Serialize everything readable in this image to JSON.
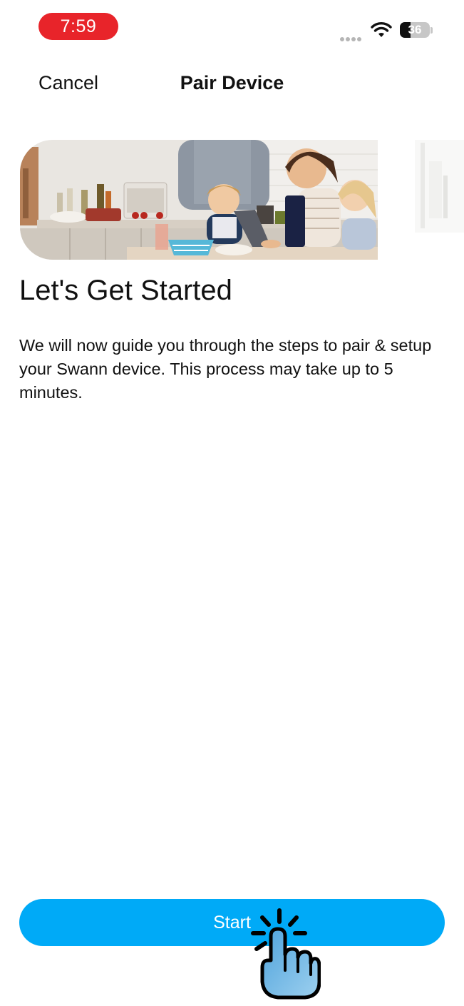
{
  "status_bar": {
    "time": "7:59",
    "time_pill_color": "#e8242a",
    "battery_level": "36",
    "battery_fraction": 0.36,
    "icons": [
      "signal-dots-icon",
      "wifi-icon",
      "battery-icon"
    ]
  },
  "nav": {
    "cancel_label": "Cancel",
    "title": "Pair Device"
  },
  "hero": {
    "image_alt": "Family in kitchen using tablet",
    "carousel_next_peek": true
  },
  "content": {
    "headline": "Let's Get Started",
    "description": "We will now guide you through the steps to pair & setup your Swann device. This process may take up to 5 minutes."
  },
  "footer": {
    "start_label": "Start",
    "button_color": "#00aaf7"
  },
  "overlay": {
    "icon": "tap-hand-icon"
  }
}
